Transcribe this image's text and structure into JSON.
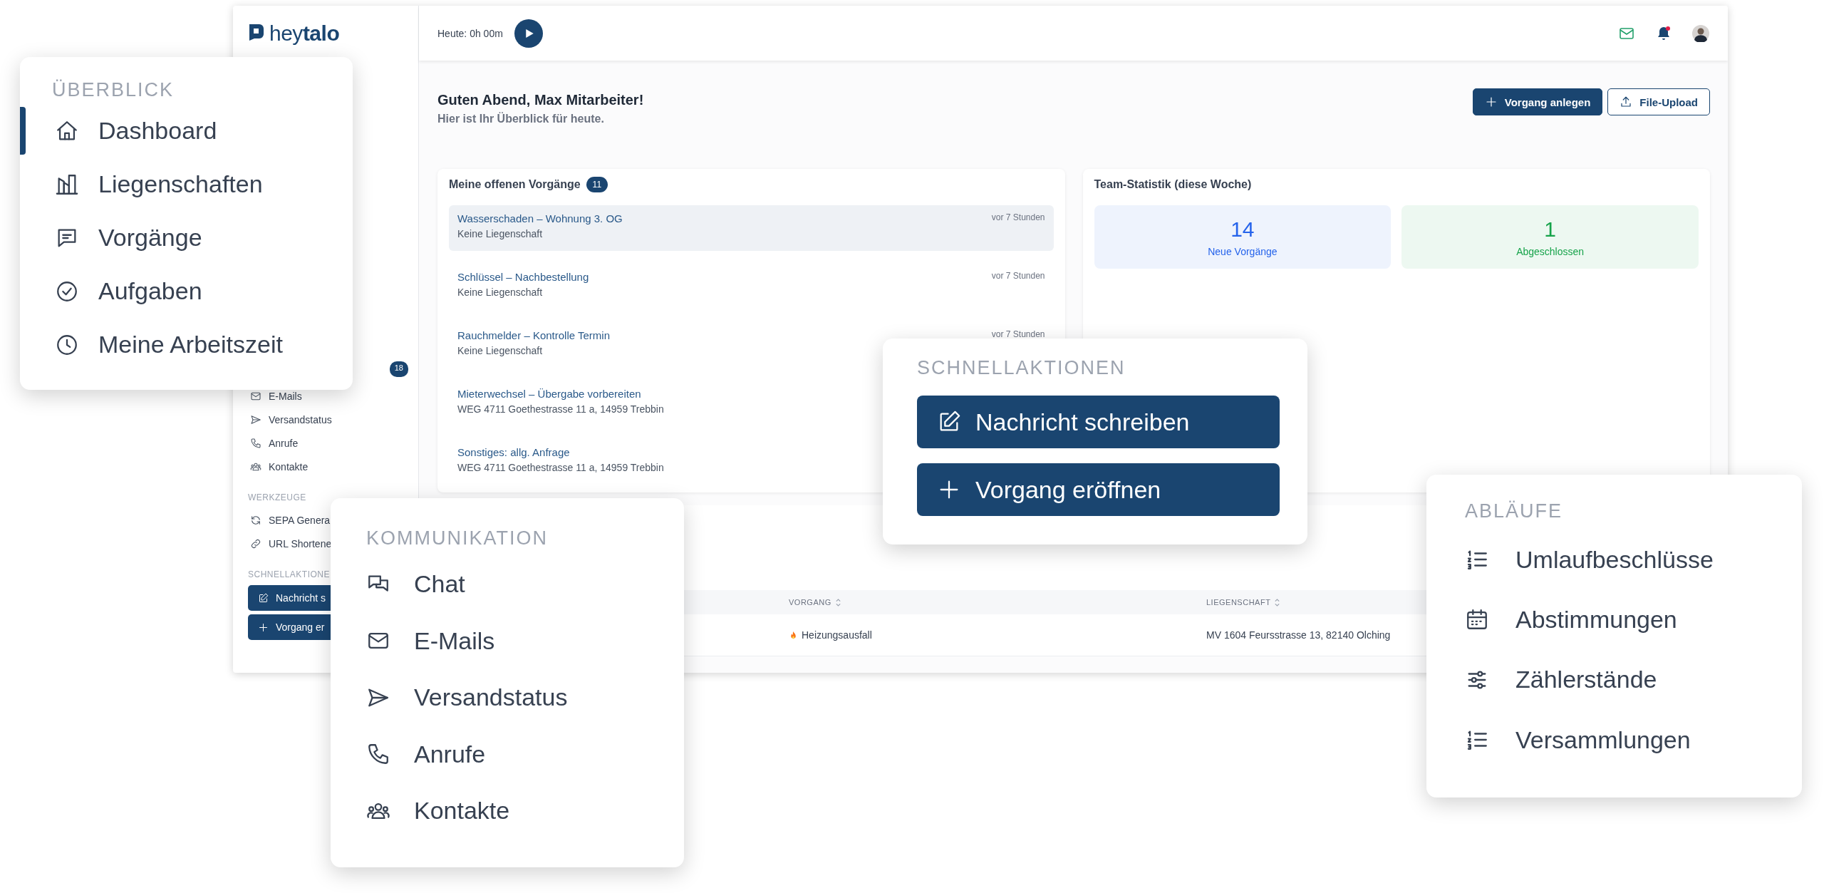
{
  "app": {
    "logo": "hey**talo**",
    "timer": "Heute: 0h 00m",
    "sidebar": {
      "badge": "18",
      "groups": [
        {
          "items": [
            {
              "label": "E-Mails"
            },
            {
              "label": "Versandstatus"
            },
            {
              "label": "Anrufe"
            },
            {
              "label": "Kontakte"
            }
          ]
        },
        {
          "heading": "WERKZEUGE",
          "items": [
            {
              "label": "SEPA Genera"
            },
            {
              "label": "URL Shortene"
            }
          ]
        },
        {
          "heading": "SCHNELLAKTIONE",
          "buttons": [
            {
              "label": "Nachricht s"
            },
            {
              "label": "Vorgang er"
            }
          ]
        }
      ]
    },
    "greeting": {
      "title": "Guten Abend, Max Mitarbeiter!",
      "subtitle": "Hier ist Ihr Überblick für heute."
    },
    "actions": [
      {
        "label": "Vorgang anlegen",
        "kind": "primary"
      },
      {
        "label": "File-Upload",
        "kind": "outline"
      }
    ],
    "open_cases": {
      "title": "Meine offenen Vorgänge",
      "count": "11",
      "items": [
        {
          "title": "Wasserschaden – Wohnung 3. OG",
          "property": "Keine Liegenschaft",
          "time": "vor 7 Stunden",
          "selected": true
        },
        {
          "title": "Schlüssel – Nachbestellung",
          "property": "Keine Liegenschaft",
          "time": "vor 7 Stunden",
          "selected": false
        },
        {
          "title": "Rauchmelder – Kontrolle Termin",
          "property": "Keine Liegenschaft",
          "time": "vor 7 Stunden",
          "selected": false
        },
        {
          "title": "Mieterwechsel – Übergabe vorbereiten",
          "property": "WEG 4711 Goethestrasse 11 a, 14959 Trebbin",
          "selected": false
        },
        {
          "title": "Sonstiges: allg. Anfrage",
          "property": "WEG 4711 Goethestrasse 11 a, 14959 Trebbin",
          "selected": false
        }
      ]
    },
    "team_stats": {
      "title": "Team-Statistik (diese Woche)",
      "tiles": [
        {
          "value": "14",
          "label": "Neue Vorgänge",
          "color": "#2563eb"
        },
        {
          "value": "1",
          "label": "Abgeschlossen",
          "color": "#16a34a"
        }
      ]
    },
    "table": {
      "columns": [
        {
          "label": "VORGANG"
        },
        {
          "label": "LIEGENSCHAFT"
        }
      ],
      "rows": [
        {
          "case": "Heizungsausfall",
          "property": "MV 1604 Feursstrasse 13, 82140 Olching"
        }
      ]
    }
  },
  "overview_menu": {
    "heading": "ÜBERBLICK",
    "items": [
      {
        "label": "Dashboard",
        "selected": true
      },
      {
        "label": "Liegenschaften",
        "selected": false
      },
      {
        "label": "Vorgänge",
        "selected": false
      },
      {
        "label": "Aufgaben",
        "selected": false
      },
      {
        "label": "Meine Arbeitszeit",
        "selected": false
      }
    ]
  },
  "quick_actions": {
    "heading": "SCHNELLAKTIONEN",
    "buttons": [
      {
        "label": "Nachricht schreiben"
      },
      {
        "label": "Vorgang eröffnen"
      }
    ]
  },
  "communication_menu": {
    "heading": "KOMMUNIKATION",
    "items": [
      {
        "label": "Chat"
      },
      {
        "label": "E-Mails"
      },
      {
        "label": "Versandstatus"
      },
      {
        "label": "Anrufe"
      },
      {
        "label": "Kontakte"
      }
    ]
  },
  "processes_menu": {
    "heading": "ABLÄUFE",
    "items": [
      {
        "label": "Umlaufbeschlüsse"
      },
      {
        "label": "Abstimmungen"
      },
      {
        "label": "Zählerstände"
      },
      {
        "label": "Versammlungen"
      }
    ]
  }
}
